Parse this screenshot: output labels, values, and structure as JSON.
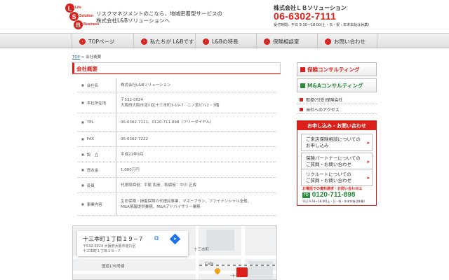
{
  "header": {
    "logo_letters": [
      "L",
      "S",
      "B"
    ],
    "logo_words": [
      "Life",
      "Solution",
      "Business"
    ],
    "tagline_line1": "リスクマネジメントのこなら、地域密着型サービスの",
    "tagline_line2": "株式会社L&Bソリューションへ",
    "company_name": "株式会社ＬＢソリューション",
    "phone": "06-6302-7111",
    "hours": "受付時間：平日 9:30～18:00(土・日・祝・年末年始は休業)"
  },
  "nav": {
    "items": [
      {
        "label": "TOPページ"
      },
      {
        "label": "私たちが L&Bです"
      },
      {
        "label": "L&Bの特長"
      },
      {
        "label": "保険相談室"
      },
      {
        "label": "お問い合わせ"
      }
    ]
  },
  "breadcrumb": {
    "top": "TOP",
    "separator": " > ",
    "current": "会社概要"
  },
  "section": {
    "title": "会社概要"
  },
  "info": {
    "rows": [
      {
        "key": "会社名",
        "value": "株式会社L&Bソリューション"
      },
      {
        "key": "本社所在地",
        "value1": "〒532-0024",
        "value2": "大阪府大阪市淀川区十三本町1-19-7　ニノ宮ビル2・3階"
      },
      {
        "key": "TEL",
        "value": "06-6302-7111、0120-711-898（フリーダイヤル）"
      },
      {
        "key": "FAX",
        "value": "06-6302-7222"
      },
      {
        "key": "設　立",
        "value": "平成21年9月"
      },
      {
        "key": "資本金",
        "value": "1,000万円"
      },
      {
        "key": "役員",
        "value": "代表取締役：平尾 和彦、取締役：中川 正成"
      },
      {
        "key": "事業内容",
        "value1": "生命保険・損害保険の代理店事業、マネープラン、ファイナンシャル全般、",
        "value2": "M&A情報提供業務、M&Aアドバイザリー業務"
      }
    ]
  },
  "map": {
    "title": "十三本町１丁目１９−７",
    "addr1": "〒532-0024 大阪府大阪市淀川区",
    "addr2": "十三本町１丁目１９−７",
    "label_town": "十三本町",
    "label_road": "国道176号線",
    "label_cafe": "Cafe",
    "label_station": "十三"
  },
  "sidebar": {
    "btn_insurance": "保険コンサルティング",
    "btn_ma": "M&Aコンサルティング",
    "link_company": "取扱(引受)保険会社",
    "link_access": "当社へのアクセス",
    "contact_head": "お申し込み・お問い合わせ",
    "contact_items": [
      {
        "line1": "ご来店保険相談についての",
        "line2": "お申し込み"
      },
      {
        "line1": "保険パートナーについての",
        "line2": "ご質問・お問い合わせ"
      },
      {
        "line1": "リクルートについての",
        "line2": "ご質問・お問い合わせ"
      }
    ],
    "contact_note": "お電話での資料請求・お問い合わせは",
    "free_dial_label": "FD",
    "free_dial": "0120-711-898",
    "contact_hours": "平日 9:30～18:00(土・日・祝・年末年始は休業)"
  },
  "colors": {
    "accent": "#d9201a",
    "ma_green": "#2a8b3c",
    "link_blue": "#1a5aa8"
  }
}
